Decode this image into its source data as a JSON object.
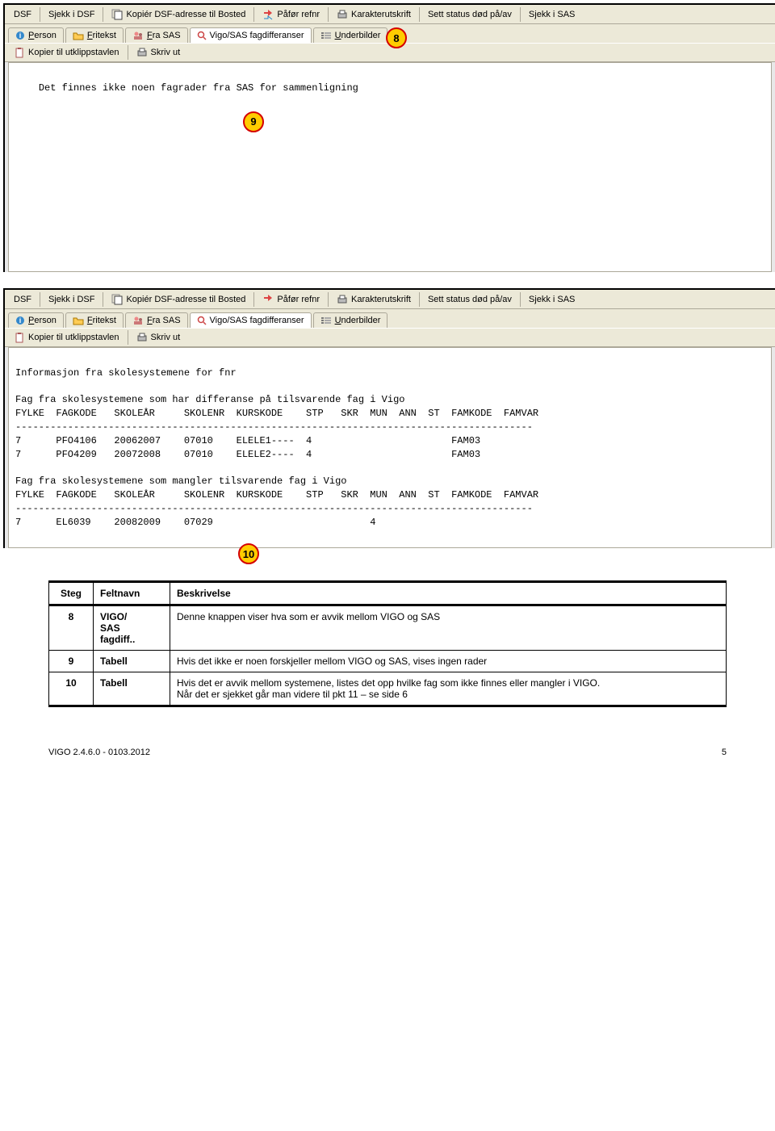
{
  "toolbar1": {
    "dsf": "DSF",
    "sjekk_dsf": "Sjekk i DSF",
    "kopier_dsf": "Kopiér DSF-adresse til Bosted",
    "pafor_refnr": "Påfør refnr",
    "karakter": "Karakterutskrift",
    "status_dod": "Sett status død på/av",
    "sjekk_sas": "Sjekk i SAS"
  },
  "tabs": {
    "person_pre": "P",
    "person": "erson",
    "fritekst_pre": "F",
    "fritekst": "ritekst",
    "fra_sas_pre": "F",
    "fra_sas": "ra SAS",
    "fagdiff": "Vigo/SAS fagdifferanser",
    "underbilder_pre": "U",
    "underbilder": "nderbilder"
  },
  "toolbar2": {
    "kopier_utklipp": "Kopier til utklippstavlen",
    "skriv_ut": "Skriv ut"
  },
  "content1": "Det finnes ikke noen fagrader fra SAS for sammenligning",
  "content2": "Informasjon fra skolesystemene for fnr\n\nFag fra skolesystemene som har differanse på tilsvarende fag i Vigo\nFYLKE  FAGKODE   SKOLEÅR     SKOLENR  KURSKODE    STP   SKR  MUN  ANN  ST  FAMKODE  FAMVAR\n-----------------------------------------------------------------------------------------\n7      PFO4106   20062007    07010    ELELE1----  4                        FAM03\n7      PFO4209   20072008    07010    ELELE2----  4                        FAM03\n\nFag fra skolesystemene som mangler tilsvarende fag i Vigo\nFYLKE  FAGKODE   SKOLEÅR     SKOLENR  KURSKODE    STP   SKR  MUN  ANN  ST  FAMKODE  FAMVAR\n-----------------------------------------------------------------------------------------\n7      EL6039    20082009    07029                           4",
  "callouts": {
    "c8": "8",
    "c9": "9",
    "c10": "10"
  },
  "table": {
    "h1": "Steg",
    "h2": "Feltnavn",
    "h3": "Beskrivelse",
    "rows": [
      {
        "steg": "8",
        "felt": "VIGO/\nSAS\nfagdiff..",
        "besk": "Denne knappen viser hva som er avvik mellom VIGO og SAS"
      },
      {
        "steg": "9",
        "felt": "Tabell",
        "besk": "Hvis det ikke er noen forskjeller mellom VIGO og SAS, vises ingen rader"
      },
      {
        "steg": "10",
        "felt": "Tabell",
        "besk": "Hvis det er avvik mellom systemene, listes det opp hvilke fag som ikke finnes eller mangler i VIGO.\nNår det er sjekket går man videre til pkt 11 – se side 6"
      }
    ]
  },
  "footer": {
    "left": "VIGO 2.4.6.0 - 0103.2012",
    "right": "5"
  }
}
